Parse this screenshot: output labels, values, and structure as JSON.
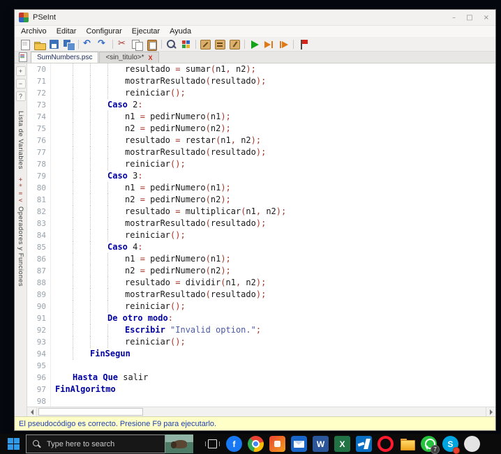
{
  "window": {
    "title": "PSeInt",
    "caption": {
      "minimize": "–",
      "maximize": "□",
      "close": "×"
    },
    "menus": [
      "Archivo",
      "Editar",
      "Configurar",
      "Ejecutar",
      "Ayuda"
    ],
    "toolbar": [
      "new-file",
      "open-file",
      "save",
      "save-as",
      "sep",
      "undo",
      "redo",
      "sep",
      "cut",
      "copy",
      "paste",
      "sep",
      "find",
      "color-grid",
      "sep",
      "wand-tool",
      "brush-tool",
      "pencil-tool",
      "sep",
      "run",
      "run-step",
      "run-to",
      "sep",
      "stop-flag"
    ]
  },
  "tabs": [
    {
      "label": "SumNumbers.psc",
      "active": true
    },
    {
      "label": "<sin_titulo>*",
      "active": false,
      "close": "X"
    }
  ],
  "sidebar": {
    "icons": [
      {
        "name": "zoom-in",
        "glyph": "+"
      },
      {
        "name": "zoom-out",
        "glyph": "−"
      },
      {
        "name": "help",
        "glyph": "?"
      }
    ],
    "panels": [
      {
        "name": "variables",
        "label": "Lista de Variables",
        "symbols": ""
      },
      {
        "name": "operators",
        "label": "Operadores y Funciones",
        "symbols": "+*=<"
      }
    ]
  },
  "editor": {
    "lines": [
      {
        "n": "70",
        "ind": 4,
        "tk": [
          [
            "pl",
            "resultado "
          ],
          [
            "op",
            "= "
          ],
          [
            "pl",
            "sumar"
          ],
          [
            "op",
            "("
          ],
          [
            "pl",
            "n1"
          ],
          [
            "op",
            ", "
          ],
          [
            "pl",
            "n2"
          ],
          [
            "op",
            ");"
          ]
        ]
      },
      {
        "n": "71",
        "ind": 4,
        "tk": [
          [
            "pl",
            "mostrarResultado"
          ],
          [
            "op",
            "("
          ],
          [
            "pl",
            "resultado"
          ],
          [
            "op",
            ");"
          ]
        ]
      },
      {
        "n": "72",
        "ind": 4,
        "tk": [
          [
            "pl",
            "reiniciar"
          ],
          [
            "op",
            "();"
          ]
        ]
      },
      {
        "n": "73",
        "ind": 3,
        "tk": [
          [
            "kw",
            "Caso "
          ],
          [
            "pl",
            "2"
          ],
          [
            "op",
            ":"
          ]
        ]
      },
      {
        "n": "74",
        "ind": 4,
        "tk": [
          [
            "pl",
            "n1 "
          ],
          [
            "op",
            "= "
          ],
          [
            "pl",
            "pedirNumero"
          ],
          [
            "op",
            "("
          ],
          [
            "pl",
            "n1"
          ],
          [
            "op",
            ");"
          ]
        ]
      },
      {
        "n": "75",
        "ind": 4,
        "tk": [
          [
            "pl",
            "n2 "
          ],
          [
            "op",
            "= "
          ],
          [
            "pl",
            "pedirNumero"
          ],
          [
            "op",
            "("
          ],
          [
            "pl",
            "n2"
          ],
          [
            "op",
            ");"
          ]
        ]
      },
      {
        "n": "76",
        "ind": 4,
        "tk": [
          [
            "pl",
            "resultado "
          ],
          [
            "op",
            "= "
          ],
          [
            "pl",
            "restar"
          ],
          [
            "op",
            "("
          ],
          [
            "pl",
            "n1"
          ],
          [
            "op",
            ", "
          ],
          [
            "pl",
            "n2"
          ],
          [
            "op",
            ");"
          ]
        ]
      },
      {
        "n": "77",
        "ind": 4,
        "tk": [
          [
            "pl",
            "mostrarResultado"
          ],
          [
            "op",
            "("
          ],
          [
            "pl",
            "resultado"
          ],
          [
            "op",
            ");"
          ]
        ]
      },
      {
        "n": "78",
        "ind": 4,
        "tk": [
          [
            "pl",
            "reiniciar"
          ],
          [
            "op",
            "();"
          ]
        ]
      },
      {
        "n": "79",
        "ind": 3,
        "tk": [
          [
            "kw",
            "Caso "
          ],
          [
            "pl",
            "3"
          ],
          [
            "op",
            ":"
          ]
        ]
      },
      {
        "n": "80",
        "ind": 4,
        "tk": [
          [
            "pl",
            "n1 "
          ],
          [
            "op",
            "= "
          ],
          [
            "pl",
            "pedirNumero"
          ],
          [
            "op",
            "("
          ],
          [
            "pl",
            "n1"
          ],
          [
            "op",
            ");"
          ]
        ]
      },
      {
        "n": "81",
        "ind": 4,
        "tk": [
          [
            "pl",
            "n2 "
          ],
          [
            "op",
            "= "
          ],
          [
            "pl",
            "pedirNumero"
          ],
          [
            "op",
            "("
          ],
          [
            "pl",
            "n2"
          ],
          [
            "op",
            ");"
          ]
        ]
      },
      {
        "n": "82",
        "ind": 4,
        "tk": [
          [
            "pl",
            "resultado "
          ],
          [
            "op",
            "= "
          ],
          [
            "pl",
            "multiplicar"
          ],
          [
            "op",
            "("
          ],
          [
            "pl",
            "n1"
          ],
          [
            "op",
            ", "
          ],
          [
            "pl",
            "n2"
          ],
          [
            "op",
            ");"
          ]
        ]
      },
      {
        "n": "83",
        "ind": 4,
        "tk": [
          [
            "pl",
            "mostrarResultado"
          ],
          [
            "op",
            "("
          ],
          [
            "pl",
            "resultado"
          ],
          [
            "op",
            ");"
          ]
        ]
      },
      {
        "n": "84",
        "ind": 4,
        "tk": [
          [
            "pl",
            "reiniciar"
          ],
          [
            "op",
            "();"
          ]
        ]
      },
      {
        "n": "85",
        "ind": 3,
        "tk": [
          [
            "kw",
            "Caso "
          ],
          [
            "pl",
            "4"
          ],
          [
            "op",
            ":"
          ]
        ]
      },
      {
        "n": "86",
        "ind": 4,
        "tk": [
          [
            "pl",
            "n1 "
          ],
          [
            "op",
            "= "
          ],
          [
            "pl",
            "pedirNumero"
          ],
          [
            "op",
            "("
          ],
          [
            "pl",
            "n1"
          ],
          [
            "op",
            ");"
          ]
        ]
      },
      {
        "n": "87",
        "ind": 4,
        "tk": [
          [
            "pl",
            "n2 "
          ],
          [
            "op",
            "= "
          ],
          [
            "pl",
            "pedirNumero"
          ],
          [
            "op",
            "("
          ],
          [
            "pl",
            "n2"
          ],
          [
            "op",
            ");"
          ]
        ]
      },
      {
        "n": "88",
        "ind": 4,
        "tk": [
          [
            "pl",
            "resultado "
          ],
          [
            "op",
            "= "
          ],
          [
            "pl",
            "dividir"
          ],
          [
            "op",
            "("
          ],
          [
            "pl",
            "n1"
          ],
          [
            "op",
            ", "
          ],
          [
            "pl",
            "n2"
          ],
          [
            "op",
            ");"
          ]
        ]
      },
      {
        "n": "89",
        "ind": 4,
        "tk": [
          [
            "pl",
            "mostrarResultado"
          ],
          [
            "op",
            "("
          ],
          [
            "pl",
            "resultado"
          ],
          [
            "op",
            ");"
          ]
        ]
      },
      {
        "n": "90",
        "ind": 4,
        "tk": [
          [
            "pl",
            "reiniciar"
          ],
          [
            "op",
            "();"
          ]
        ]
      },
      {
        "n": "91",
        "ind": 3,
        "tk": [
          [
            "kw",
            "De otro modo"
          ],
          [
            "op",
            ":"
          ]
        ]
      },
      {
        "n": "92",
        "ind": 4,
        "tk": [
          [
            "kw",
            "Escribir "
          ],
          [
            "st",
            "\"Invalid option.\""
          ],
          [
            "op",
            ";"
          ]
        ]
      },
      {
        "n": "93",
        "ind": 4,
        "tk": [
          [
            "pl",
            "reiniciar"
          ],
          [
            "op",
            "();"
          ]
        ]
      },
      {
        "n": "94",
        "ind": 2,
        "tk": [
          [
            "kw",
            "FinSegun"
          ]
        ]
      },
      {
        "n": "95",
        "ind": 0,
        "tk": []
      },
      {
        "n": "96",
        "ind": 1,
        "tk": [
          [
            "kw",
            "Hasta Que "
          ],
          [
            "pl",
            "salir"
          ]
        ]
      },
      {
        "n": "97",
        "ind": 0,
        "tk": [
          [
            "kw",
            "FinAlgoritmo"
          ]
        ]
      },
      {
        "n": "98",
        "ind": 0,
        "tk": []
      }
    ]
  },
  "status": {
    "message": "El pseudocódigo es correcto. Presione F9 para ejecutarlo."
  },
  "taskbar": {
    "search": {
      "placeholder": "Type here to search"
    },
    "icons": [
      {
        "name": "task-view"
      },
      {
        "name": "facebook",
        "letter": "f"
      },
      {
        "name": "chrome"
      },
      {
        "name": "orange-app"
      },
      {
        "name": "mail"
      },
      {
        "name": "word",
        "letter": "W"
      },
      {
        "name": "excel",
        "letter": "X"
      },
      {
        "name": "vscode"
      },
      {
        "name": "opera"
      },
      {
        "name": "file-explorer"
      },
      {
        "name": "whatsapp",
        "badge": "7",
        "badge_style": "dark"
      },
      {
        "name": "skype",
        "letter": "S",
        "badge": "",
        "badge_style": "red"
      },
      {
        "name": "partial-app"
      }
    ]
  }
}
